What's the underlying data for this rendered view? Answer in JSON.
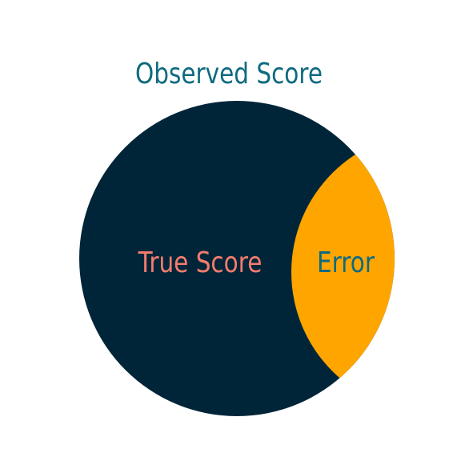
{
  "title": "Observed Score",
  "regions": [
    {
      "label": "True Score",
      "color": "#012538",
      "label_color": "#F47C6E"
    },
    {
      "label": "Error",
      "color": "#FFA500",
      "label_color": "#0E6A80"
    }
  ],
  "title_color": "#0E6A80"
}
